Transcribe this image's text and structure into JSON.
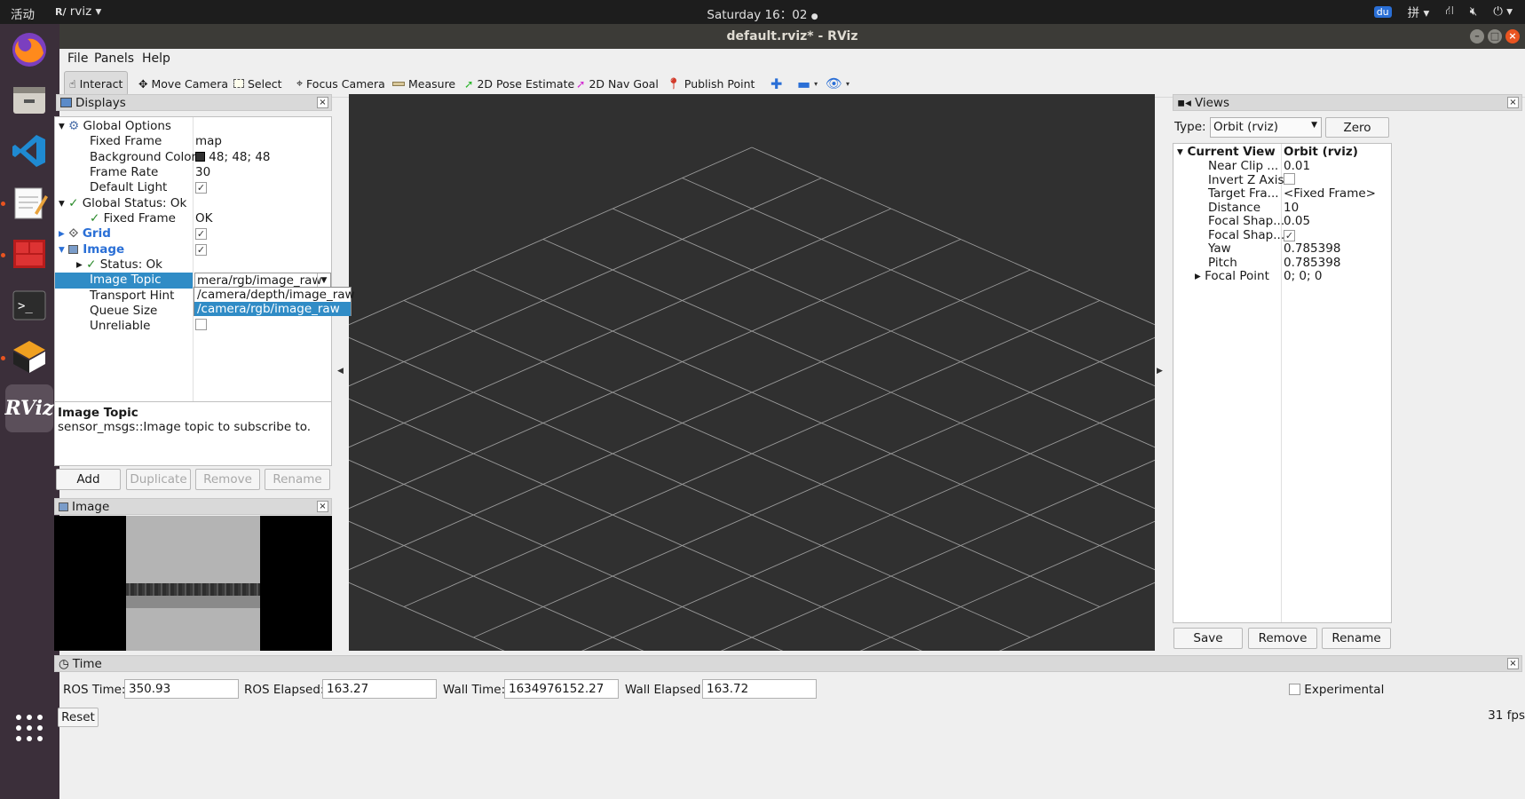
{
  "topbar": {
    "activities": "活动",
    "app_menu": "rviz",
    "clock": "Saturday 16：02",
    "tray": {
      "baidu": "du",
      "input_method": "拼"
    }
  },
  "window": {
    "title": "default.rviz* - RViz"
  },
  "menubar": [
    "File",
    "Panels",
    "Help"
  ],
  "toolbar": {
    "interact": "Interact",
    "move_camera": "Move Camera",
    "select": "Select",
    "focus_camera": "Focus Camera",
    "measure": "Measure",
    "pose_estimate": "2D Pose Estimate",
    "nav_goal": "2D Nav Goal",
    "publish_point": "Publish Point"
  },
  "displays": {
    "title": "Displays",
    "rows": {
      "global_options": "Global Options",
      "fixed_frame": {
        "label": "Fixed Frame",
        "value": "map"
      },
      "background_color": {
        "label": "Background Color",
        "value": "48; 48; 48"
      },
      "frame_rate": {
        "label": "Frame Rate",
        "value": "30"
      },
      "default_light": {
        "label": "Default Light"
      },
      "global_status": "Global Status: Ok",
      "gs_fixed_frame": {
        "label": "Fixed Frame",
        "value": "OK"
      },
      "grid": "Grid",
      "image": "Image",
      "status": "Status: Ok",
      "image_topic": {
        "label": "Image Topic",
        "value": "mera/rgb/image_raw"
      },
      "transport_hint": "Transport Hint",
      "queue_size": "Queue Size",
      "unreliable": "Unreliable"
    },
    "dropdown_options": [
      "/camera/depth/image_raw",
      "/camera/rgb/image_raw"
    ],
    "description": {
      "title": "Image Topic",
      "text": "sensor_msgs::Image topic to subscribe to."
    },
    "buttons": {
      "add": "Add",
      "duplicate": "Duplicate",
      "remove": "Remove",
      "rename": "Rename"
    }
  },
  "image_panel": {
    "title": "Image"
  },
  "views": {
    "title": "Views",
    "type_label": "Type:",
    "type_value": "Orbit (rviz)",
    "zero": "Zero",
    "current_view": {
      "label": "Current View",
      "value": "Orbit (rviz)"
    },
    "props": [
      {
        "label": "Near Clip ...",
        "value": "0.01"
      },
      {
        "label": "Invert Z Axis",
        "value": ""
      },
      {
        "label": "Target Fra...",
        "value": "<Fixed Frame>"
      },
      {
        "label": "Distance",
        "value": "10"
      },
      {
        "label": "Focal Shap...",
        "value": "0.05"
      },
      {
        "label": "Focal Shap...",
        "value": ""
      },
      {
        "label": "Yaw",
        "value": "0.785398"
      },
      {
        "label": "Pitch",
        "value": "0.785398"
      },
      {
        "label": "Focal Point",
        "value": "0; 0; 0"
      }
    ],
    "buttons": {
      "save": "Save",
      "remove": "Remove",
      "rename": "Rename"
    }
  },
  "time": {
    "title": "Time",
    "ros_time": {
      "label": "ROS Time:",
      "value": "350.93"
    },
    "ros_elapsed": {
      "label": "ROS Elapsed:",
      "value": "163.27"
    },
    "wall_time": {
      "label": "Wall Time:",
      "value": "1634976152.27"
    },
    "wall_elapsed": {
      "label": "Wall Elapsed:",
      "value": "163.72"
    },
    "experimental": "Experimental",
    "reset": "Reset",
    "fps": "31 fps"
  },
  "colors": {
    "viewport_bg": "#303030",
    "accent": "#e95420",
    "selection": "#308cc6"
  }
}
